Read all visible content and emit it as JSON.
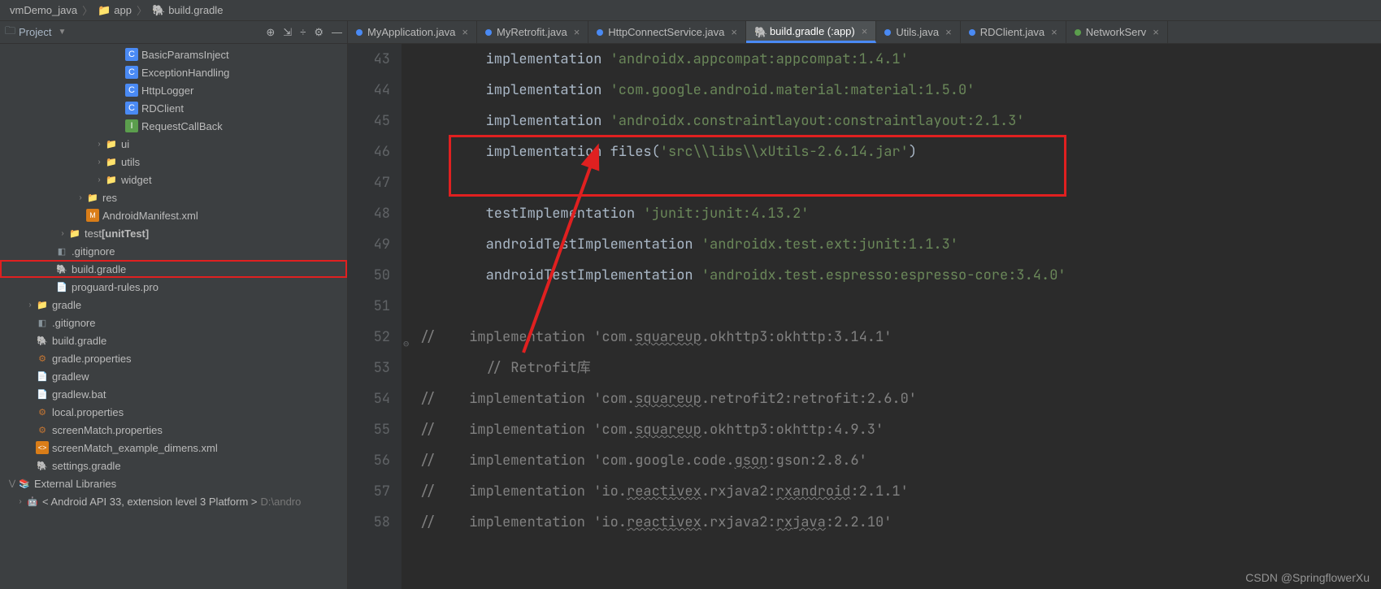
{
  "breadcrumb": {
    "root": "vmDemo_java",
    "p1": "app",
    "p2": "build.gradle"
  },
  "project": {
    "title": "Project",
    "items": [
      {
        "indent": "indent15",
        "ico": "kt",
        "icoTxt": "C",
        "label": "BasicParamsInject"
      },
      {
        "indent": "indent15",
        "ico": "kt",
        "icoTxt": "C",
        "label": "ExceptionHandling"
      },
      {
        "indent": "indent15",
        "ico": "kt",
        "icoTxt": "C",
        "label": "HttpLogger"
      },
      {
        "indent": "indent15",
        "ico": "kt",
        "icoTxt": "C",
        "label": "RDClient"
      },
      {
        "indent": "indent15",
        "ico": "intf",
        "icoTxt": "I",
        "label": "RequestCallBack"
      },
      {
        "indent": "indent12",
        "arrow": ">",
        "ico": "fld",
        "icoTxt": "📁",
        "label": "ui"
      },
      {
        "indent": "indent12",
        "arrow": ">",
        "ico": "fld",
        "icoTxt": "📁",
        "label": "utils"
      },
      {
        "indent": "indent12",
        "arrow": ">",
        "ico": "fld",
        "icoTxt": "📁",
        "label": "widget"
      },
      {
        "indent": "indent9",
        "arrow": ">",
        "ico": "fld",
        "icoTxt": "📁",
        "label": "res"
      },
      {
        "indent": "indent9",
        "ico": "xml",
        "icoTxt": "M",
        "label": "AndroidManifest.xml"
      },
      {
        "indent": "indent6",
        "arrow": ">",
        "ico": "fld",
        "icoTxt": "📁",
        "label": "test",
        "bold": "[unitTest]"
      },
      {
        "indent": "indent5",
        "ico": "file",
        "icoTxt": "◧",
        "label": ".gitignore"
      },
      {
        "indent": "indent5",
        "ico": "gradle",
        "icoTxt": "🐘",
        "label": "build.gradle",
        "hl": true
      },
      {
        "indent": "indent5",
        "ico": "file",
        "icoTxt": "📄",
        "label": "proguard-rules.pro"
      },
      {
        "indent": "indent3",
        "arrow": ">",
        "ico": "fld",
        "icoTxt": "📁",
        "label": "gradle"
      },
      {
        "indent": "indent3",
        "ico": "file",
        "icoTxt": "◧",
        "label": ".gitignore"
      },
      {
        "indent": "indent3",
        "ico": "gradle",
        "icoTxt": "🐘",
        "label": "build.gradle"
      },
      {
        "indent": "indent3",
        "ico": "cfg",
        "icoTxt": "⚙",
        "label": "gradle.properties"
      },
      {
        "indent": "indent3",
        "ico": "file",
        "icoTxt": "📄",
        "label": "gradlew"
      },
      {
        "indent": "indent3",
        "ico": "file",
        "icoTxt": "📄",
        "label": "gradlew.bat"
      },
      {
        "indent": "indent3",
        "ico": "cfg",
        "icoTxt": "⚙",
        "label": "local.properties"
      },
      {
        "indent": "indent3",
        "ico": "cfg",
        "icoTxt": "⚙",
        "label": "screenMatch.properties"
      },
      {
        "indent": "indent3",
        "ico": "xml",
        "icoTxt": "<>",
        "label": "screenMatch_example_dimens.xml"
      },
      {
        "indent": "indent3",
        "ico": "gradle",
        "icoTxt": "🐘",
        "label": "settings.gradle"
      },
      {
        "indent": "indent1",
        "arrow": "v",
        "ico": "fld",
        "icoTxt": "📚",
        "label": "External Libraries"
      },
      {
        "indent": "indent2",
        "arrow": ">",
        "ico": "fld",
        "icoTxt": "🤖",
        "label": "< Android API 33, extension level 3 Platform >",
        "dim": "D:\\andro"
      }
    ]
  },
  "tabs": [
    {
      "ico": "kblue",
      "label": "MyApplication.java"
    },
    {
      "ico": "kblue",
      "label": "MyRetrofit.java"
    },
    {
      "ico": "kblue",
      "label": "HttpConnectService.java"
    },
    {
      "ico": "gradle",
      "label": "build.gradle (:app)",
      "active": true
    },
    {
      "ico": "kblue",
      "label": "Utils.java"
    },
    {
      "ico": "kblue",
      "label": "RDClient.java"
    },
    {
      "ico": "kgreen",
      "label": "NetworkServ"
    }
  ],
  "code": {
    "start": 43,
    "lines": [
      {
        "n": 43,
        "seg": [
          {
            "c": "k-id",
            "t": "        implementation "
          },
          {
            "c": "k-str",
            "t": "'androidx.appcompat:appcompat:1.4.1'"
          }
        ]
      },
      {
        "n": 44,
        "seg": [
          {
            "c": "k-id",
            "t": "        implementation "
          },
          {
            "c": "k-str",
            "t": "'com.google.android.material:material:1.5.0'"
          }
        ]
      },
      {
        "n": 45,
        "seg": [
          {
            "c": "k-id",
            "t": "        implementation "
          },
          {
            "c": "k-str",
            "t": "'androidx.constraintlayout:constraintlayout:2.1.3'"
          }
        ]
      },
      {
        "n": 46,
        "seg": [
          {
            "c": "k-id",
            "t": "        implementation files("
          },
          {
            "c": "k-str",
            "t": "'src\\\\libs\\\\xUtils-2.6.14.jar'"
          },
          {
            "c": "k-id",
            "t": ")"
          }
        ]
      },
      {
        "n": 47,
        "seg": [
          {
            "c": "",
            "t": ""
          }
        ]
      },
      {
        "n": 48,
        "seg": [
          {
            "c": "k-id",
            "t": "        testImplementation "
          },
          {
            "c": "k-str",
            "t": "'junit:junit:4.13.2'"
          }
        ]
      },
      {
        "n": 49,
        "seg": [
          {
            "c": "k-id",
            "t": "        androidTestImplementation "
          },
          {
            "c": "k-str",
            "t": "'androidx.test.ext:junit:1.1.3'"
          }
        ]
      },
      {
        "n": 50,
        "seg": [
          {
            "c": "k-id",
            "t": "        androidTestImplementation "
          },
          {
            "c": "k-str",
            "t": "'androidx.test.espresso:espresso-core:3.4.0'"
          }
        ]
      },
      {
        "n": 51,
        "seg": [
          {
            "c": "",
            "t": ""
          }
        ]
      },
      {
        "n": 52,
        "seg": [
          {
            "c": "k-cmt",
            "t": "//    implementation 'com."
          },
          {
            "c": "k-cmt sq",
            "t": "squareup"
          },
          {
            "c": "k-cmt",
            "t": ".okhttp3:okhttp:3.14.1'"
          }
        ]
      },
      {
        "n": 53,
        "seg": [
          {
            "c": "k-cmt",
            "t": "        // Retrofit库"
          }
        ]
      },
      {
        "n": 54,
        "seg": [
          {
            "c": "k-cmt",
            "t": "//    implementation 'com."
          },
          {
            "c": "k-cmt sq",
            "t": "squareup"
          },
          {
            "c": "k-cmt",
            "t": ".retrofit2:retrofit:2.6.0'"
          }
        ]
      },
      {
        "n": 55,
        "seg": [
          {
            "c": "k-cmt",
            "t": "//    implementation 'com."
          },
          {
            "c": "k-cmt sq",
            "t": "squareup"
          },
          {
            "c": "k-cmt",
            "t": ".okhttp3:okhttp:4.9.3'"
          }
        ]
      },
      {
        "n": 56,
        "seg": [
          {
            "c": "k-cmt",
            "t": "//    implementation 'com.google.code."
          },
          {
            "c": "k-cmt sq",
            "t": "gson"
          },
          {
            "c": "k-cmt",
            "t": ":gson:2.8.6'"
          }
        ]
      },
      {
        "n": 57,
        "seg": [
          {
            "c": "k-cmt",
            "t": "//    implementation 'io."
          },
          {
            "c": "k-cmt sq",
            "t": "reactivex"
          },
          {
            "c": "k-cmt",
            "t": ".rxjava2:"
          },
          {
            "c": "k-cmt sq",
            "t": "rxandroid"
          },
          {
            "c": "k-cmt",
            "t": ":2.1.1'"
          }
        ]
      },
      {
        "n": 58,
        "seg": [
          {
            "c": "k-cmt",
            "t": "//    implementation 'io."
          },
          {
            "c": "k-cmt sq",
            "t": "reactivex"
          },
          {
            "c": "k-cmt",
            "t": ".rxjava2:"
          },
          {
            "c": "k-cmt sq",
            "t": "rxjava"
          },
          {
            "c": "k-cmt",
            "t": ":2.2.10'"
          }
        ]
      }
    ]
  },
  "watermark": "CSDN @SpringflowerXu"
}
